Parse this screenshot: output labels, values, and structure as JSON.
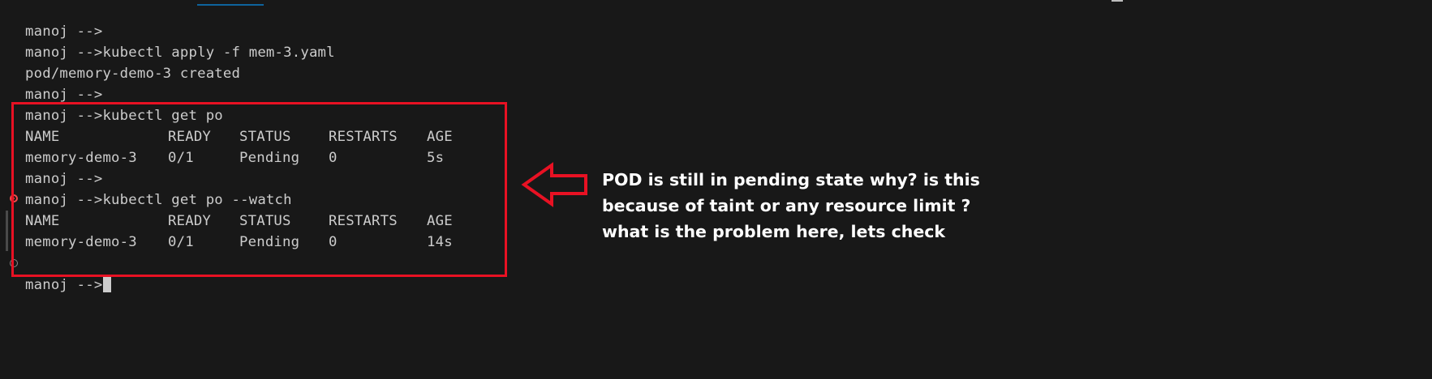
{
  "colors": {
    "background": "#181818",
    "text": "#cccccc",
    "highlight": "#e81123",
    "annotation_text": "#ffffff"
  },
  "terminal": {
    "lines": [
      "manoj -->",
      "manoj -->kubectl apply -f mem-3.yaml",
      "pod/memory-demo-3 created",
      "manoj -->",
      "manoj -->kubectl get po",
      "manoj -->",
      "manoj -->kubectl get po --watch"
    ],
    "prompt": "manoj -->",
    "table1": {
      "headers": [
        "NAME",
        "READY",
        "STATUS",
        "RESTARTS",
        "AGE"
      ],
      "row": [
        "memory-demo-3",
        "0/1",
        "Pending",
        "0",
        "5s"
      ]
    },
    "table2": {
      "headers": [
        "NAME",
        "READY",
        "STATUS",
        "RESTARTS",
        "AGE"
      ],
      "row": [
        "memory-demo-3",
        "0/1",
        "Pending",
        "0",
        "14s"
      ]
    }
  },
  "annotation": {
    "lines": [
      "POD is still in pending state why? is this",
      "because of taint or any resource limit ?",
      "what is the problem here, lets check"
    ],
    "arrow_icon": "left-arrow-outline"
  }
}
